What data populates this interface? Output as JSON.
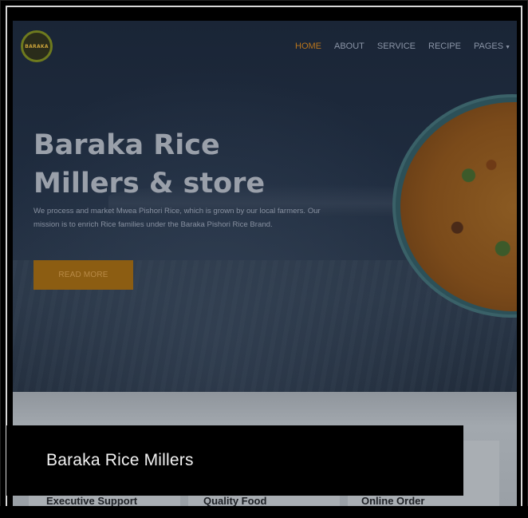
{
  "brand": {
    "logo_text": "BARAKA"
  },
  "nav": {
    "items": [
      {
        "label": "HOME",
        "active": true
      },
      {
        "label": "ABOUT",
        "active": false
      },
      {
        "label": "SERVICE",
        "active": false
      },
      {
        "label": "RECIPE",
        "active": false
      },
      {
        "label": "PAGES",
        "active": false,
        "dropdown": true
      }
    ]
  },
  "hero": {
    "title_line1": "Baraka Rice",
    "title_line2": "Millers & store",
    "description": "We process and market Mwea Pishori Rice, which is grown by our local farmers. Our mission is to enrich Rice families under the Baraka Pishori Rice Brand.",
    "button_label": "READ MORE"
  },
  "features": [
    {
      "title": "Executive Support"
    },
    {
      "title": "Quality Food"
    },
    {
      "title": "Online Order"
    }
  ],
  "caption": {
    "text": "Baraka Rice Millers"
  },
  "colors": {
    "accent": "#b8741c",
    "button": "#8c5d12",
    "overlay": "#000000"
  }
}
